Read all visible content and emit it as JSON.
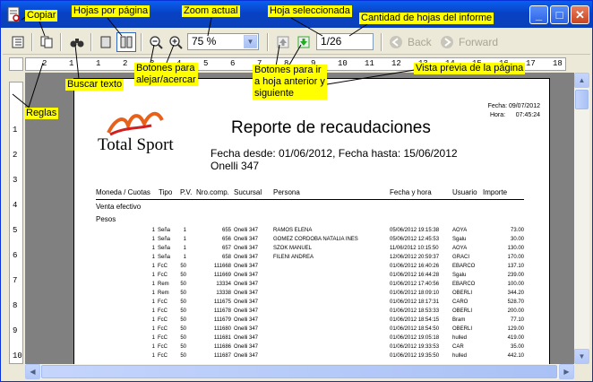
{
  "window": {
    "min": "_",
    "max": "□",
    "close": "✕"
  },
  "toolbar": {
    "zoom_value": "75 %",
    "page_value": "1/26",
    "back_label": "Back",
    "forward_label": "Forward"
  },
  "ruler": {
    "h": [
      "2",
      "1",
      "1",
      "2",
      "3",
      "4",
      "5",
      "6",
      "7",
      "8",
      "9",
      "10",
      "11",
      "12",
      "13",
      "14",
      "15",
      "16",
      "17",
      "18"
    ],
    "v": [
      "1",
      "2",
      "3",
      "4",
      "5",
      "6",
      "7",
      "8",
      "9",
      "10"
    ]
  },
  "annotations": {
    "copiar": "Copiar",
    "hojas_pagina": "Hojas por página",
    "zoom": "Zoom actual",
    "hoja_sel": "Hoja seleccionada",
    "cantidad": "Cantidad de hojas del informe",
    "buscar": "Buscar texto",
    "botones_zoom": "Botones para\nalejar/acercar",
    "botones_ir": "Botones para ir\na hoja anterior y\nsiguiente",
    "vista": "Vista previa de la página",
    "reglas": "Reglas"
  },
  "report": {
    "logo_text": "Total Sport",
    "title": "Reporte de recaudaciones",
    "subtitle1": "Fecha desde: 01/06/2012, Fecha hasta: 15/06/2012",
    "subtitle2": "Onelli 347",
    "meta": "Fecha: 09/07/2012\nHora:      07:45:24",
    "headers": [
      "Moneda / Cuotas",
      "Tipo",
      "P.V.",
      "Nro.comp.",
      "Sucursal",
      "Persona",
      "Fecha y hora",
      "Usuario",
      "Importe"
    ],
    "section1": "Venta efectivo",
    "section2": "Pesos",
    "rows": [
      [
        "1",
        "Seña",
        "1",
        "655",
        "Onelli 347",
        "RAMOS ELENA",
        "05/06/2012 19:15:38",
        "AOYA",
        "73.00"
      ],
      [
        "1",
        "Seña",
        "1",
        "656",
        "Onelli 347",
        "GOMEZ CORDOBA NATALIA INES",
        "05/06/2012 12:45:53",
        "Sgalu",
        "30.00"
      ],
      [
        "1",
        "Seña",
        "1",
        "657",
        "Onelli 347",
        "SZOK MANUEL",
        "11/06/2012 10:15:50",
        "AOYA",
        "130.00"
      ],
      [
        "1",
        "Seña",
        "1",
        "658",
        "Onelli 347",
        "FILENI ANDREA",
        "12/06/2012 20:59:37",
        "GRACI",
        "170.00"
      ],
      [
        "1",
        "FcC",
        "50",
        "111668",
        "Onelli 347",
        "",
        "01/06/2012 16:40:26",
        "EBARCO",
        "137.10"
      ],
      [
        "1",
        "FcC",
        "50",
        "111669",
        "Onelli 347",
        "",
        "01/06/2012 16:44:28",
        "Sgalu",
        "239.00"
      ],
      [
        "1",
        "Rem",
        "50",
        "13334",
        "Onelli 347",
        "",
        "01/06/2012 17:40:56",
        "EBARCO",
        "100.00"
      ],
      [
        "1",
        "Rem",
        "50",
        "13338",
        "Onelli 347",
        "",
        "01/06/2012 18:09:10",
        "OBERLI",
        "344.20"
      ],
      [
        "1",
        "FcC",
        "50",
        "111675",
        "Onelli 347",
        "",
        "01/06/2012 18:17:31",
        "CARO",
        "528.70"
      ],
      [
        "1",
        "FcC",
        "50",
        "111678",
        "Onelli 347",
        "",
        "01/06/2012 18:53:33",
        "OBERLI",
        "200.00"
      ],
      [
        "1",
        "FcC",
        "50",
        "111679",
        "Onelli 347",
        "",
        "01/06/2012 18:54:15",
        "Bram",
        "77.10"
      ],
      [
        "1",
        "FcC",
        "50",
        "111680",
        "Onelli 347",
        "",
        "01/06/2012 18:54:50",
        "OBERLI",
        "129.00"
      ],
      [
        "1",
        "FcC",
        "50",
        "111681",
        "Onelli 347",
        "",
        "01/06/2012 19:05:18",
        "hulled",
        "419.00"
      ],
      [
        "1",
        "FcC",
        "50",
        "111686",
        "Onelli 347",
        "",
        "01/06/2012 19:33:53",
        "CAR",
        "35.00"
      ],
      [
        "1",
        "FcC",
        "50",
        "111687",
        "Onelli 347",
        "",
        "01/06/2012 19:35:50",
        "hulled",
        "442.10"
      ]
    ]
  }
}
